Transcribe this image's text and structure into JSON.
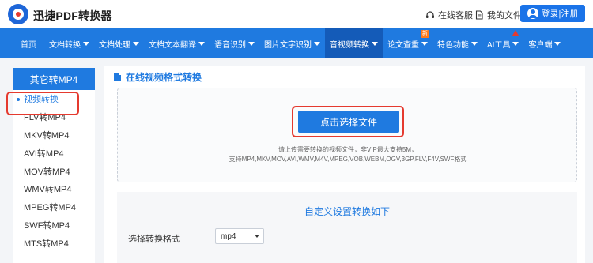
{
  "header": {
    "brand": "迅捷PDF转换器",
    "service_label": "在线客服",
    "files_label": "我的文件",
    "login_label": "登录|注册"
  },
  "nav": {
    "items": [
      {
        "label": "首页",
        "has_caret": false
      },
      {
        "label": "文档转换",
        "has_caret": true
      },
      {
        "label": "文档处理",
        "has_caret": true
      },
      {
        "label": "文档文本翻译",
        "has_caret": true
      },
      {
        "label": "语音识别",
        "has_caret": true
      },
      {
        "label": "图片文字识别",
        "has_caret": true
      },
      {
        "label": "音视频转换",
        "has_caret": true,
        "active": true
      },
      {
        "label": "论文查重",
        "has_caret": true,
        "badge": "新"
      },
      {
        "label": "特色功能",
        "has_caret": true
      },
      {
        "label": "AI工具",
        "has_caret": true
      },
      {
        "label": "客户端",
        "has_caret": true
      }
    ]
  },
  "sidebar": {
    "title": "其它转MP4",
    "items": [
      {
        "label": "视频转换",
        "active": true
      },
      {
        "label": "FLV转MP4"
      },
      {
        "label": "MKV转MP4"
      },
      {
        "label": "AVI转MP4"
      },
      {
        "label": "MOV转MP4"
      },
      {
        "label": "WMV转MP4"
      },
      {
        "label": "MPEG转MP4"
      },
      {
        "label": "SWF转MP4"
      },
      {
        "label": "MTS转MP4"
      }
    ]
  },
  "main": {
    "title": "在线视频格式转换",
    "upload_button": "点击选择文件",
    "hint_line1": "请上传需要转换的视频文件，非VIP最大支持5M，",
    "hint_line2": "支持MP4,MKV,MOV,AVI,WMV,M4V,MPEG,VOB,WEBM,OGV,3GP,FLV,F4V,SWF格式",
    "settings_title": "自定义设置转换如下",
    "format_label": "选择转换格式",
    "format_value": "mp4"
  },
  "colors": {
    "accent": "#1f7ae0",
    "nav_active": "#145bb8",
    "highlight": "#e53a2f",
    "badge": "#ff7a1a"
  }
}
